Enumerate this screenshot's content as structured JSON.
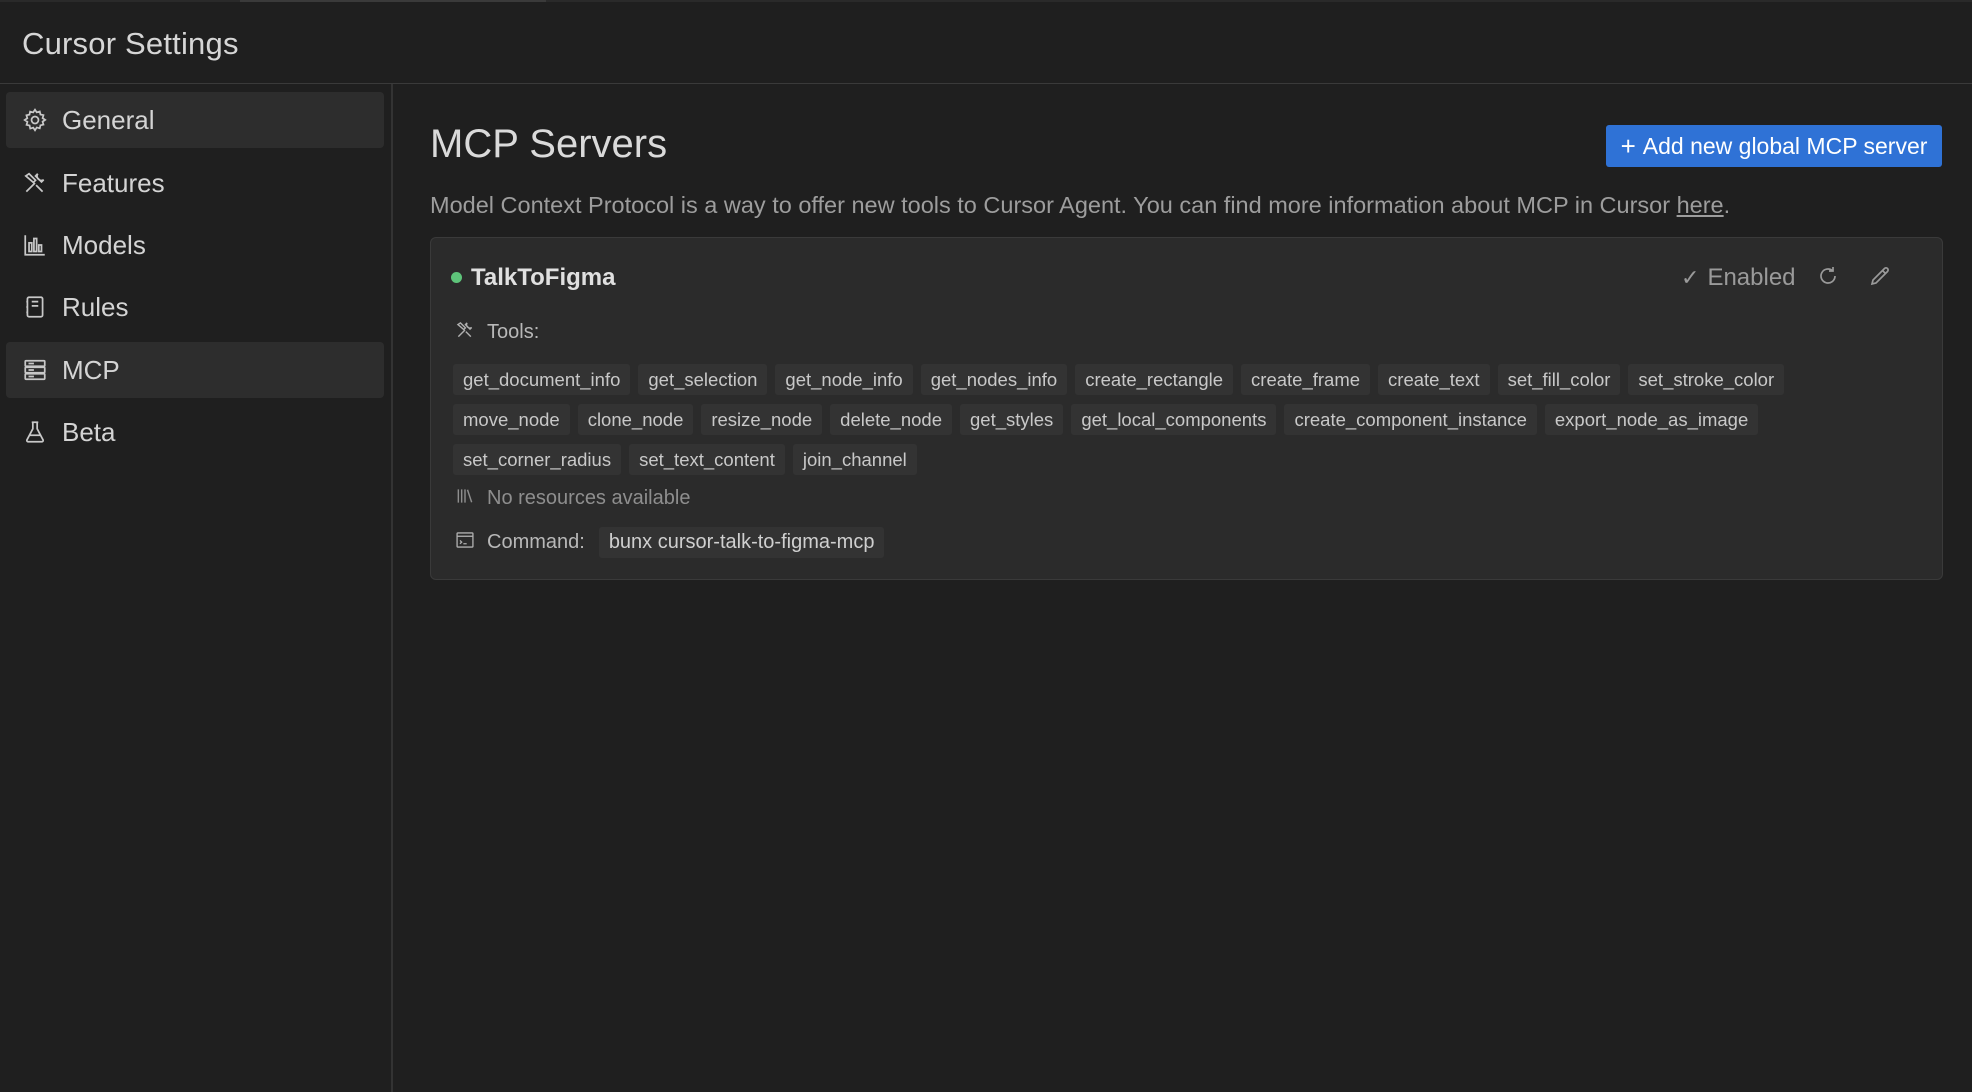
{
  "app": {
    "title": "Cursor Settings"
  },
  "sidebar": {
    "items": [
      {
        "label": "General",
        "icon": "gear-icon",
        "active": true
      },
      {
        "label": "Features",
        "icon": "tools-icon",
        "active": false
      },
      {
        "label": "Models",
        "icon": "bar-chart-icon",
        "active": false
      },
      {
        "label": "Rules",
        "icon": "notebook-icon",
        "active": false
      },
      {
        "label": "MCP",
        "icon": "server-icon",
        "active": true
      },
      {
        "label": "Beta",
        "icon": "flask-icon",
        "active": false
      }
    ]
  },
  "main": {
    "title": "MCP Servers",
    "add_button": "Add new global MCP server",
    "description": "Model Context Protocol is a way to offer new tools to Cursor Agent. You can find more information about MCP in Cursor ",
    "description_link": "here",
    "description_end": "."
  },
  "server": {
    "name": "TalkToFigma",
    "status_color": "#5ec47a",
    "enabled_label": "Enabled",
    "tools_label": "Tools:",
    "tools": [
      [
        "get_document_info",
        "get_selection",
        "get_node_info",
        "get_nodes_info",
        "create_rectangle",
        "create_frame",
        "create_text",
        "set_fill_color",
        "set_stroke_color"
      ],
      [
        "move_node",
        "clone_node",
        "resize_node",
        "delete_node",
        "get_styles",
        "get_local_components",
        "create_component_instance",
        "export_node_as_image"
      ],
      [
        "set_corner_radius",
        "set_text_content",
        "join_channel"
      ]
    ],
    "resources_label": "No resources available",
    "command_label": "Command:",
    "command": "bunx cursor-talk-to-figma-mcp"
  },
  "colors": {
    "accent": "#2f72d6",
    "background": "#1f1f1f",
    "card": "#2b2b2b"
  }
}
